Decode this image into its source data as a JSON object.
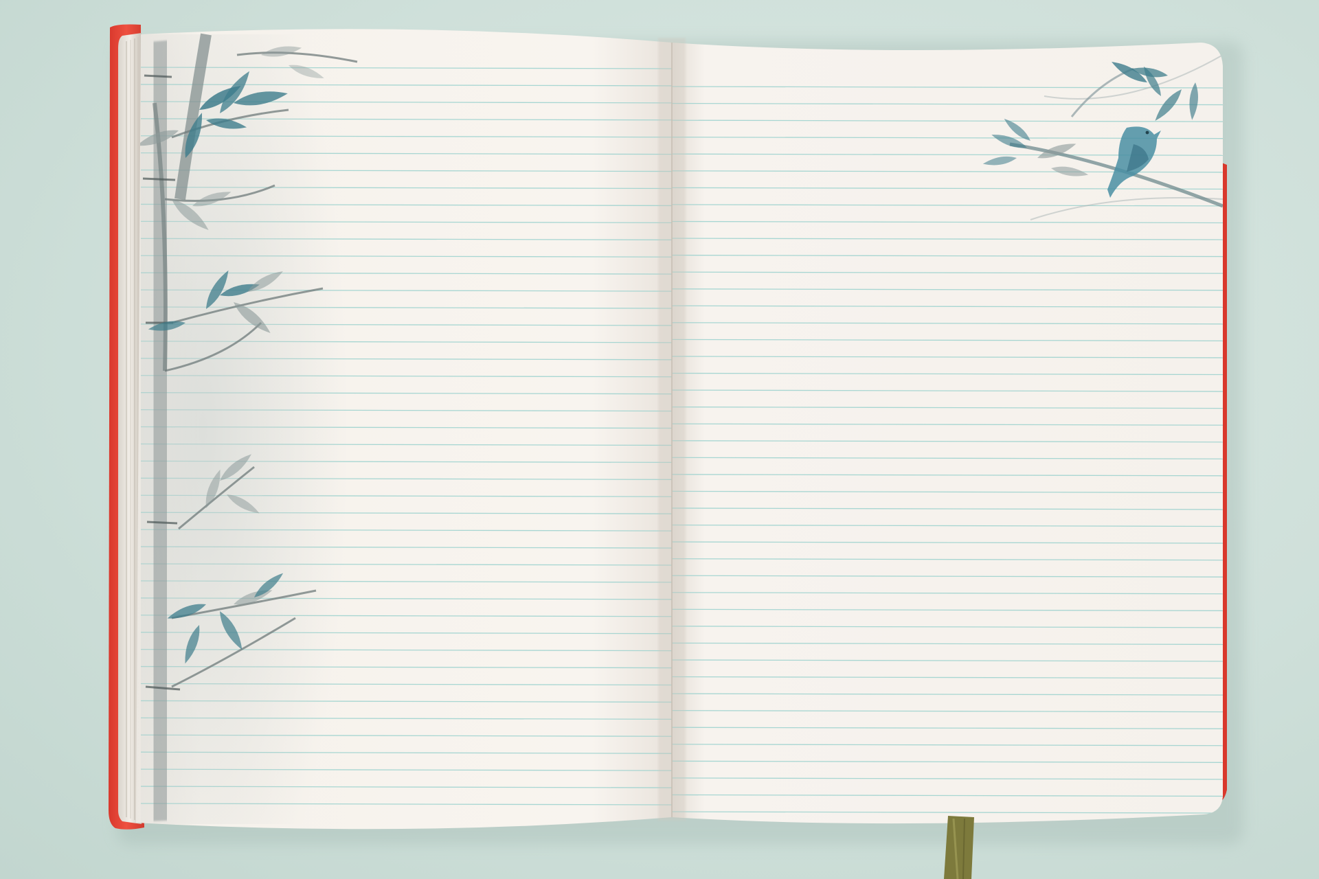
{
  "scene": {
    "subject": "open-ruled-notebook",
    "colors": {
      "background": "#d3e3dd",
      "cover": "#e8473a",
      "cover_dark": "#c7322a",
      "paper": "#f8f4ef",
      "paper_shadow": "#e6e0d8",
      "rule_line": "#9fd3cf",
      "bamboo_ink": "#3f7d8c",
      "bamboo_grey": "#8c9a9a",
      "ribbon": "#7d7a3c"
    },
    "left_page": {
      "ruled_lines": 44,
      "illustration": "bamboo-ink-painting"
    },
    "right_page": {
      "ruled_lines": 44,
      "illustration": "bird-on-bamboo-branch"
    }
  }
}
